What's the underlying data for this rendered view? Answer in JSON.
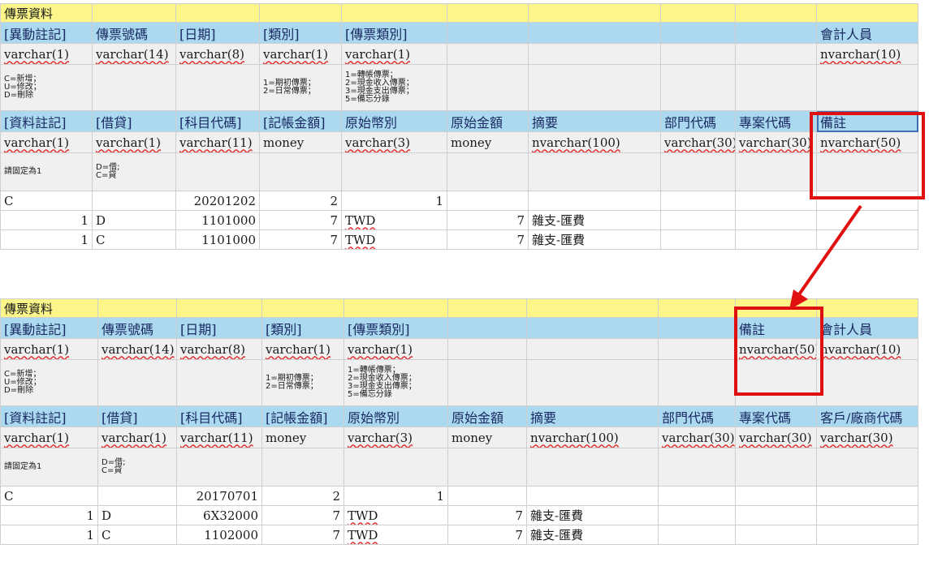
{
  "sheet1": {
    "title": "傳票資料",
    "header1": [
      "[異動註記]",
      "傳票號碼",
      "[日期]",
      "[類別]",
      "[傳票類別]",
      "",
      "",
      "",
      "",
      "會計人員"
    ],
    "types1": [
      "varchar(1)",
      "varchar(14)",
      "varchar(8)",
      "varchar(1)",
      "varchar(1)",
      "",
      "",
      "",
      "",
      "nvarchar(10)"
    ],
    "notes1": [
      "C=新增；\nU=修改；\nD=刪除",
      "",
      "",
      "1=期初傳票；\n2=日常傳票；",
      "1=轉帳傳票；\n2=現金收入傳票；\n3=現金支出傳票；\n5=備忘分錄",
      "",
      "",
      "",
      "",
      ""
    ],
    "header2": [
      "[資料註記]",
      "[借貸]",
      "[科目代碼]",
      "[記帳金額]",
      "原始幣別",
      "原始金額",
      "摘要",
      "部門代碼",
      "專案代碼",
      "備註"
    ],
    "types2": [
      "varchar(1)",
      "varchar(1)",
      "varchar(11)",
      "money",
      "varchar(3)",
      "money",
      "nvarchar(100)",
      "varchar(30)",
      "varchar(30)",
      "nvarchar(50)"
    ],
    "notes2": [
      "請固定為1",
      "D=借;\nC=貸",
      "",
      "",
      "",
      "",
      "",
      "",
      "",
      ""
    ],
    "rows": [
      [
        "C",
        "",
        "20201202",
        "2",
        "1",
        "",
        "",
        "",
        "",
        ""
      ],
      [
        "1",
        "D",
        "1101000",
        "7",
        "TWD",
        "7",
        "雜支-匯費",
        "",
        "",
        ""
      ],
      [
        "1",
        "C",
        "1101000",
        "7",
        "TWD",
        "7",
        "雜支-匯費",
        "",
        "",
        ""
      ]
    ]
  },
  "sheet2": {
    "title": "傳票資料",
    "header1": [
      "[異動註記]",
      "傳票號碼",
      "[日期]",
      "[類別]",
      "[傳票類別]",
      "",
      "",
      "",
      "備註",
      "會計人員"
    ],
    "types1": [
      "varchar(1)",
      "varchar(14)",
      "varchar(8)",
      "varchar(1)",
      "varchar(1)",
      "",
      "",
      "",
      "nvarchar(50)",
      "nvarchar(10)"
    ],
    "notes1": [
      "C=新增；\nU=修改；\nD=刪除",
      "",
      "",
      "1=期初傳票；\n2=日常傳票；",
      "1=轉帳傳票；\n2=現金收入傳票；\n3=現金支出傳票；\n5=備忘分錄",
      "",
      "",
      "",
      "",
      ""
    ],
    "header2": [
      "[資料註記]",
      "[借貸]",
      "[科目代碼]",
      "[記帳金額]",
      "原始幣別",
      "原始金額",
      "摘要",
      "部門代碼",
      "專案代碼",
      "客戶/廠商代碼"
    ],
    "types2": [
      "varchar(1)",
      "varchar(1)",
      "varchar(11)",
      "money",
      "varchar(3)",
      "money",
      "nvarchar(100)",
      "varchar(30)",
      "varchar(30)",
      "varchar(30)"
    ],
    "notes2": [
      "請固定為1",
      "D=借;\nC=貸",
      "",
      "",
      "",
      "",
      "",
      "",
      "",
      ""
    ],
    "rows": [
      [
        "C",
        "",
        "20170701",
        "2",
        "1",
        "",
        "",
        "",
        "",
        ""
      ],
      [
        "1",
        "D",
        "6X32000",
        "7",
        "TWD",
        "7",
        "雜支-匯費",
        "",
        "",
        ""
      ],
      [
        "1",
        "C",
        "1102000",
        "7",
        "TWD",
        "7",
        "雜支-匯費",
        "",
        "",
        ""
      ]
    ]
  },
  "annotation": {
    "color": "#e01010"
  }
}
